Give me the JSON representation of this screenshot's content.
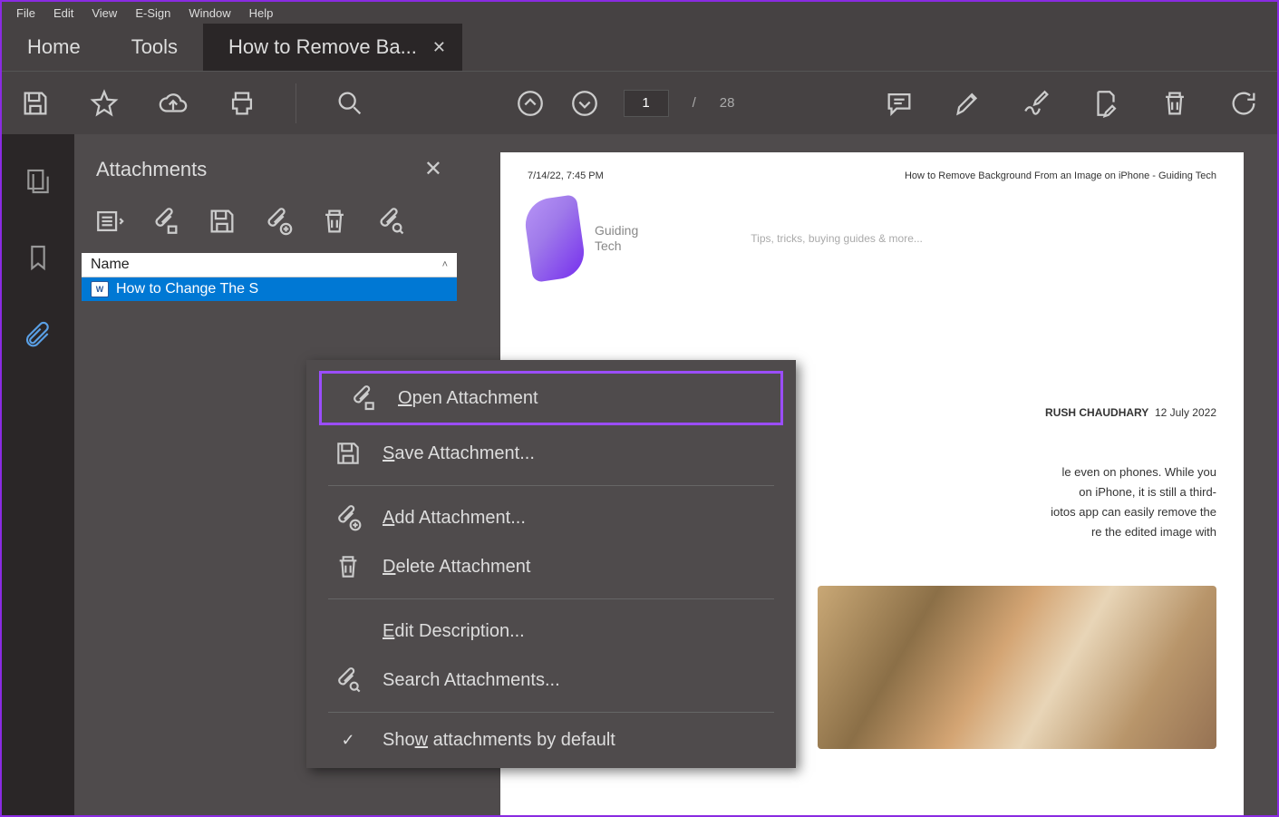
{
  "menubar": [
    "File",
    "Edit",
    "View",
    "E-Sign",
    "Window",
    "Help"
  ],
  "tabs": {
    "home": "Home",
    "tools": "Tools",
    "doc": "How to Remove Ba..."
  },
  "pagenav": {
    "current": "1",
    "sep": "/",
    "total": "28"
  },
  "panel": {
    "title": "Attachments",
    "column": "Name",
    "item": "How to Change The S"
  },
  "context": {
    "open": "pen Attachment",
    "open_pre": "O",
    "save": "ave Attachment...",
    "save_pre": "S",
    "add": "dd Attachment...",
    "add_pre": "A",
    "delete": "elete Attachment",
    "delete_pre": "D",
    "edit": "dit Description...",
    "edit_pre": "E",
    "search": "Search Attachments...",
    "show_pre": "Sho",
    "show_u": "w",
    "show_post": " attachments by default"
  },
  "doc": {
    "timestamp": "7/14/22, 7:45 PM",
    "title": "How to Remove Background From an Image on iPhone - Guiding Tech",
    "brand1": "Guiding",
    "brand2": "Tech",
    "tagline": "Tips, tricks, buying guides & more...",
    "author": "RUSH CHAUDHARY",
    "date": "12 July 2022",
    "p1": "le even on phones.  While you",
    "p2": " on iPhone, it is still a third-",
    "p3": "iotos app can easily remove the",
    "p4": "re the edited image with"
  }
}
